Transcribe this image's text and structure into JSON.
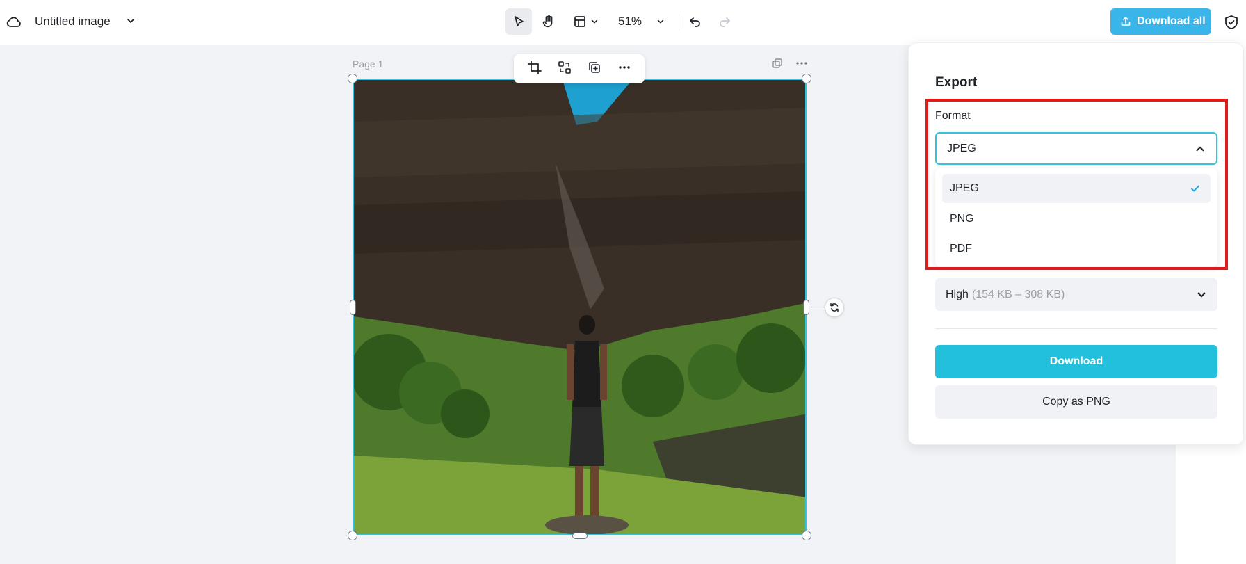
{
  "header": {
    "doc_title": "Untitled image",
    "zoom": "51%",
    "download_all_label": "Download all"
  },
  "canvas": {
    "page_label": "Page 1"
  },
  "export_panel": {
    "title": "Export",
    "format_label": "Format",
    "format_selected": "JPEG",
    "format_options": [
      "JPEG",
      "PNG",
      "PDF"
    ],
    "quality_value": "High",
    "quality_size": "(154 KB – 308 KB)",
    "download_label": "Download",
    "copy_label": "Copy as PNG"
  },
  "colors": {
    "accent": "#23c0db",
    "download_all_bg": "#3ab5ea",
    "selection_border": "#33c4dc",
    "highlight": "#e01b1b"
  }
}
